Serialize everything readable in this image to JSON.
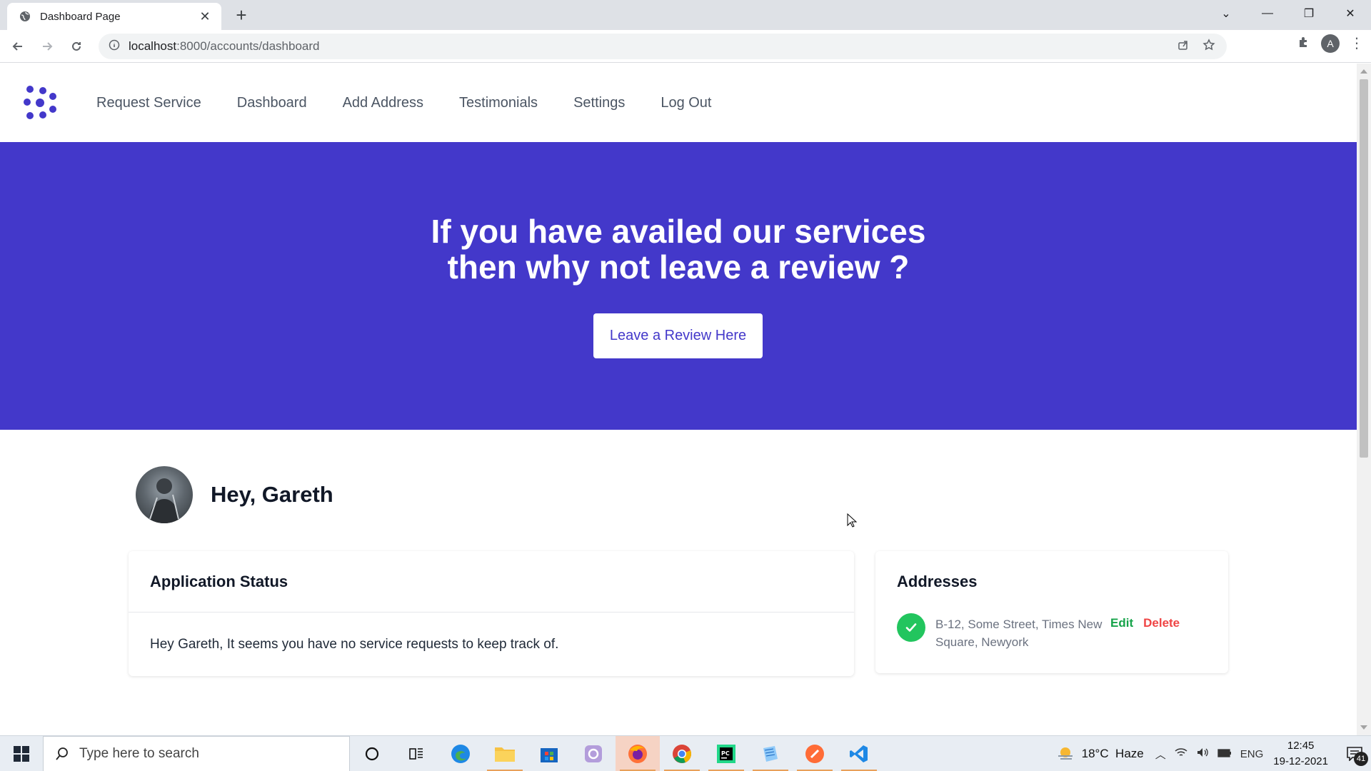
{
  "browser": {
    "tab_title": "Dashboard Page",
    "url_host": "localhost",
    "url_rest": ":8000/accounts/dashboard",
    "profile_initial": "A"
  },
  "nav": {
    "items": [
      {
        "label": "Request Service"
      },
      {
        "label": "Dashboard"
      },
      {
        "label": "Add Address"
      },
      {
        "label": "Testimonials"
      },
      {
        "label": "Settings"
      },
      {
        "label": "Log Out"
      }
    ]
  },
  "hero": {
    "title_line1": "If you have availed our services",
    "title_line2": "then why not leave a review ?",
    "button_label": "Leave a Review Here",
    "bg_color": "#4338ca"
  },
  "user": {
    "greeting": "Hey, Gareth"
  },
  "application_status": {
    "title": "Application Status",
    "message": "Hey Gareth, It seems you have no service requests to keep track of."
  },
  "addresses": {
    "title": "Addresses",
    "items": [
      {
        "text": "B-12, Some Street, Times New Square, Newyork",
        "edit_label": "Edit",
        "delete_label": "Delete"
      }
    ]
  },
  "taskbar": {
    "search_placeholder": "Type here to search",
    "weather": "18°C  Haze",
    "language": "ENG",
    "time": "12:45",
    "date": "19-12-2021",
    "notification_count": "41"
  }
}
